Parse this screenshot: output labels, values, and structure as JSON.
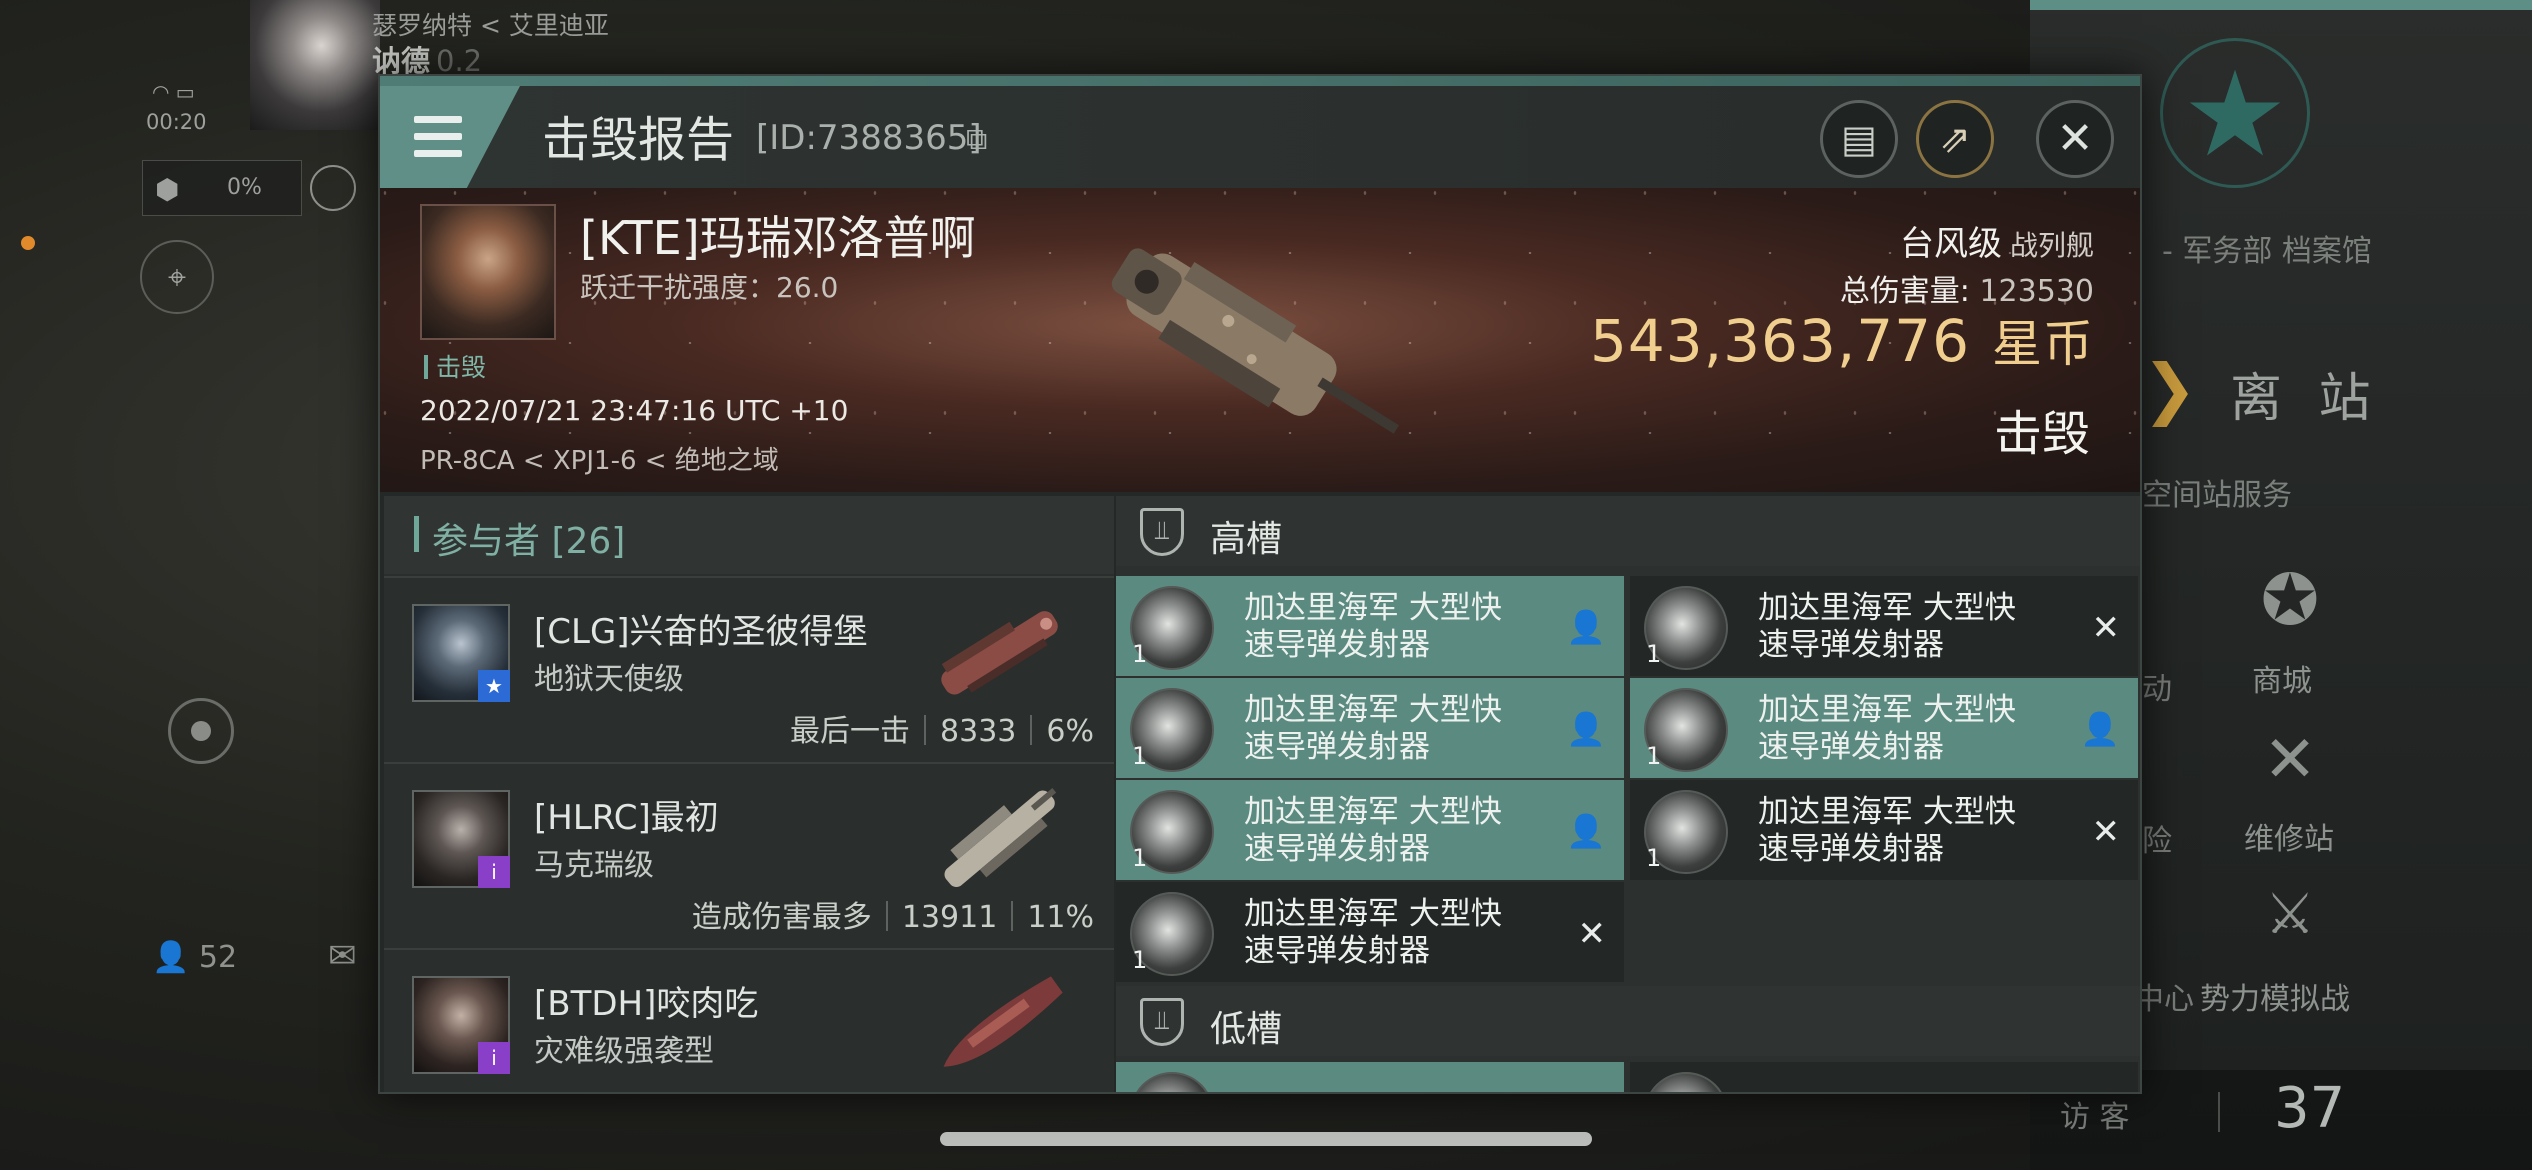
{
  "background": {
    "system_path": "瑟罗纳特 < 艾里迪亚",
    "system_name": "讷德",
    "security": "0.2",
    "time": "00:20",
    "cargo_pct": "0%",
    "local_count": "52",
    "archive_label": "- 军务部 档案馆",
    "undock_label": "离 站",
    "station_services_label": "空间站服务",
    "store_label": "商城",
    "repair_label": "维修站",
    "faction_sim_label": "势力模拟战",
    "clipped_label_a": "动",
    "clipped_label_b": "险",
    "clipped_label_c": "中心",
    "visitors_label": "访 客",
    "visitors_count": "37"
  },
  "dialog": {
    "title": "击毁报告",
    "id_text": "[ID:7388365]",
    "buttons": {
      "menu_icon": "hamburger-icon",
      "clipboard_icon": "clipboard-icon",
      "share_icon": "share-icon",
      "close_icon": "close-icon"
    }
  },
  "victim": {
    "name": "[KTE]玛瑞邓洛普啊",
    "warp_scramble": "跃迁干扰强度：26.0",
    "tag": "击毁",
    "timestamp": "2022/07/21 23:47:16 UTC +10",
    "location": "PR-8CA < XPJ1-6 < 绝地之域",
    "ship_name": "台风级",
    "ship_class": "战列舰",
    "total_damage_label": "总伤害量:",
    "total_damage": "123530",
    "isk_value": "543,363,776",
    "isk_unit": "星币",
    "status": "击毁"
  },
  "participants": {
    "title": "参与者 [26]",
    "items": [
      {
        "name": "[CLG]兴奋的圣彼得堡",
        "ship": "地狱天使级",
        "role": "最后一击",
        "damage": "8333",
        "percent": "6%",
        "badge": "★",
        "badge_color": "#2c6bd6"
      },
      {
        "name": "[HLRC]最初",
        "ship": "马克瑞级",
        "role": "造成伤害最多",
        "damage": "13911",
        "percent": "11%",
        "badge": "i",
        "badge_color": "#8a3fc9"
      },
      {
        "name": "[BTDH]咬肉吃",
        "ship": "灾难级强袭型",
        "role": "",
        "damage": "",
        "percent": "",
        "badge": "i",
        "badge_color": "#8a3fc9"
      }
    ]
  },
  "fittings": {
    "high_slot_title": "高槽",
    "low_slot_title": "低槽",
    "high_modules": [
      {
        "line1": "加达里海军 大型快",
        "line2": "速导弹发射器",
        "qty": "1",
        "state": "pilot"
      },
      {
        "line1": "加达里海军 大型快",
        "line2": "速导弹发射器",
        "qty": "1",
        "state": "destroyed"
      },
      {
        "line1": "加达里海军 大型快",
        "line2": "速导弹发射器",
        "qty": "1",
        "state": "pilot"
      },
      {
        "line1": "加达里海军 大型快",
        "line2": "速导弹发射器",
        "qty": "1",
        "state": "pilot"
      },
      {
        "line1": "加达里海军 大型快",
        "line2": "速导弹发射器",
        "qty": "1",
        "state": "pilot"
      },
      {
        "line1": "加达里海军 大型快",
        "line2": "速导弹发射器",
        "qty": "1",
        "state": "destroyed"
      },
      {
        "line1": "加达里海军 大型快",
        "line2": "速导弹发射器",
        "qty": "1",
        "state": "destroyed"
      }
    ]
  },
  "colors": {
    "accent": "#5b8a81",
    "isk": "#f0cf8e",
    "participant_title": "#7fb0a3"
  }
}
